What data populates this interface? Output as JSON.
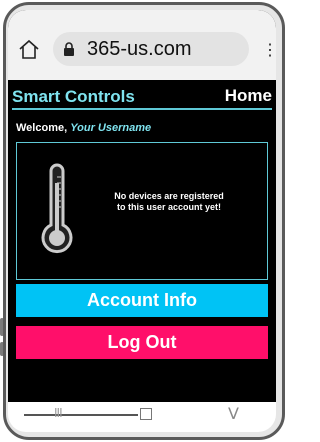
{
  "browser": {
    "url": "365-us.com",
    "home_icon": "home-icon",
    "lock_icon": "lock-icon",
    "menu_glyph": "⋮"
  },
  "app": {
    "title": "Smart Controls",
    "home_link": "Home",
    "welcome_label": "Welcome, ",
    "username": "Your Username",
    "no_devices_line1": "No devices are registered",
    "no_devices_line2": "to this user account yet!",
    "account_button": "Account Info",
    "logout_button": "Log Out",
    "colors": {
      "accent": "#7fe3ef",
      "account_button": "#00c3f5",
      "logout_button": "#ff0f6a",
      "background": "#000000"
    }
  },
  "nav": {
    "recent_glyph": "III",
    "back_glyph": "V"
  }
}
